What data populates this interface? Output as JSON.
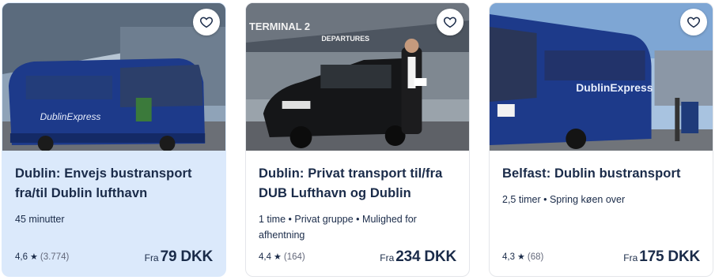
{
  "cards": [
    {
      "title": "Dublin: Envejs bustransport fra/til Dublin lufthavn",
      "meta": "45 minutter",
      "rating": "4,6",
      "reviews": "(3.774)",
      "from_label": "Fra",
      "price": "79 DKK",
      "image_text": "DublinExpress",
      "image_icon": "blue-coach-bus-photo",
      "wishlist_icon": "heart-icon"
    },
    {
      "title": "Dublin: Privat transport til/fra DUB Lufthavn og Dublin",
      "meta": "1 time • Privat gruppe • Mulighed for afhentning",
      "rating": "4,4",
      "reviews": "(164)",
      "from_label": "Fra",
      "price": "234 DKK",
      "image_text_1": "TERMINAL 2",
      "image_text_2": "DEPARTURES",
      "image_icon": "black-van-chauffeur-photo",
      "wishlist_icon": "heart-icon"
    },
    {
      "title": "Belfast: Dublin bustransport",
      "meta": "2,5 timer • Spring køen over",
      "rating": "4,3",
      "reviews": "(68)",
      "from_label": "Fra",
      "price": "175 DKK",
      "image_text": "DublinExpress",
      "image_icon": "blue-coach-bus-photo",
      "wishlist_icon": "heart-icon"
    }
  ],
  "star_glyph": "★",
  "colors": {
    "text": "#1a2b49",
    "highlight": "#dbe9fb",
    "bus_blue": "#1d3a8a"
  }
}
